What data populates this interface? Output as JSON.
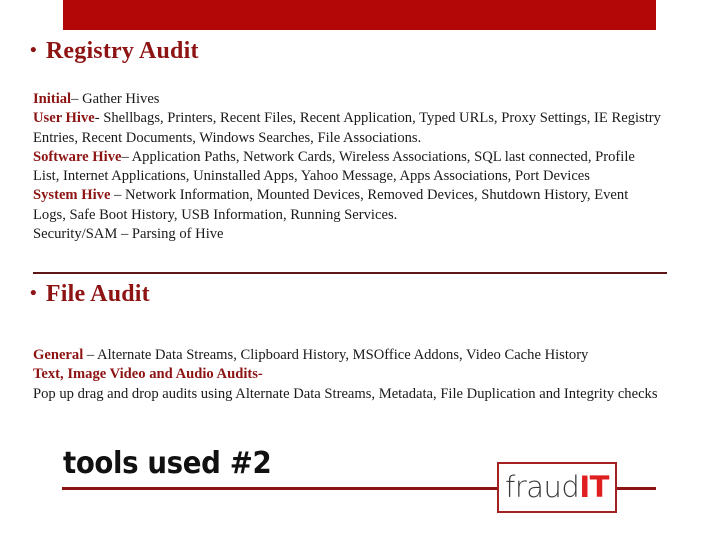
{
  "slide": {
    "banner_color": "#B30707",
    "heading_color": "#8E1414",
    "accent_red": "#E02020"
  },
  "sections": [
    {
      "heading": "Registry Audit",
      "bullet_glyph": "•",
      "paragraphs": [
        {
          "lead": "Initial",
          "text": "– Gather Hives"
        },
        {
          "lead": "User Hive",
          "text": "- Shellbags, Printers, Recent Files, Recent Application, Typed URLs, Proxy Settings, IE Registry Entries, Recent Documents, Windows Searches, File Associations."
        },
        {
          "lead": "Software Hive",
          "text": "– Application Paths, Network Cards, Wireless Associations, SQL last connected, Profile List, Internet Applications, Uninstalled Apps, Yahoo Message, Apps Associations, Port Devices"
        },
        {
          "lead": "System Hive",
          "text": " – Network Information, Mounted Devices, Removed Devices, Shutdown History, Event Logs, Safe Boot History, USB Information, Running Services."
        },
        {
          "lead": "",
          "text": "Security/SAM – Parsing of Hive"
        }
      ]
    },
    {
      "heading": "File Audit",
      "bullet_glyph": "•",
      "paragraphs": [
        {
          "lead": "General",
          "text": " – Alternate Data Streams, Clipboard History, MSOffice Addons, Video Cache History"
        },
        {
          "lead": "Text, Image Video and Audio Audits-",
          "text": ""
        },
        {
          "lead": "",
          "text": "Pop up drag and drop audits using Alternate Data Streams, Metadata, File Duplication and Integrity checks"
        }
      ]
    }
  ],
  "footer": {
    "title": "tools used #2",
    "logo": {
      "primary": "fraud",
      "accent": "IT"
    }
  }
}
